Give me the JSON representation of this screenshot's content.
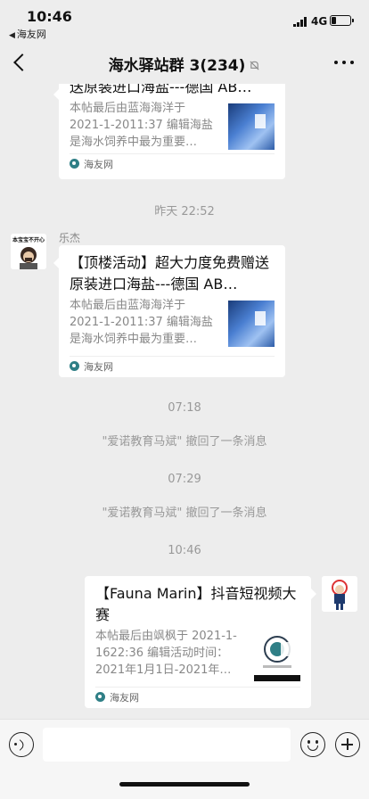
{
  "status_bar": {
    "time": "10:46",
    "back_app": "海友网",
    "network": "4G"
  },
  "nav": {
    "title": "海水驿站群 3(234)"
  },
  "messages": [
    {
      "kind": "card",
      "title": "送原装进口海盐---德国 AB…",
      "desc": "本帖最后由蓝海海洋于 2021-1-2011:37 编辑海盐是海水饲养中最为重要…",
      "source": "海友网"
    },
    {
      "kind": "timestamp",
      "text": "昨天 22:52"
    },
    {
      "kind": "card",
      "sender": "乐杰",
      "avatar_caption": "本宝宝不开心",
      "title": "【顶楼活动】超大力度免费赠送原装进口海盐---德国 AB…",
      "desc": "本帖最后由蓝海海洋于 2021-1-2011:37 编辑海盐是海水饲养中最为重要…",
      "source": "海友网"
    },
    {
      "kind": "timestamp",
      "text": "07:18"
    },
    {
      "kind": "notice",
      "text": "\"爱诺教育马斌\" 撤回了一条消息"
    },
    {
      "kind": "timestamp",
      "text": "07:29"
    },
    {
      "kind": "notice",
      "text": "\"爱诺教育马斌\" 撤回了一条消息"
    },
    {
      "kind": "timestamp",
      "text": "10:46"
    },
    {
      "kind": "card",
      "title": "【Fauna Marin】抖音短视频大赛",
      "desc": "本帖最后由飒枫于 2021-1-1622:36 编辑活动时间：2021年1月1日-2021年…",
      "source": "海友网"
    }
  ],
  "icons": {
    "back": "back-chevron-icon",
    "mute": "bell-off-icon",
    "more": "more-dots-icon",
    "voice": "voice-icon",
    "emoji": "emoji-icon",
    "plus": "plus-icon",
    "source": "haiyou-logo-icon"
  },
  "colors": {
    "background": "#ededed",
    "card": "#ffffff",
    "meta_text": "#999999"
  }
}
